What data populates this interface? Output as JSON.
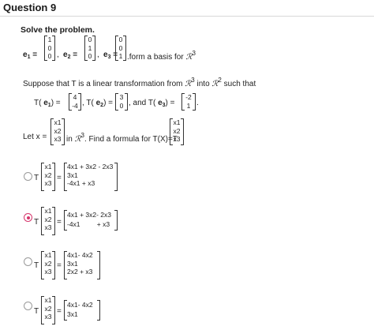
{
  "header": {
    "title": "Question 9"
  },
  "prompt": "Solve the problem.",
  "basis": {
    "e1_label": "e",
    "e1_sub": "1",
    "eq": "=",
    "e1": [
      "1",
      "0",
      "0"
    ],
    "e2_label": "e",
    "e2_sub": "2",
    "e2": [
      "0",
      "1",
      "0"
    ],
    "e3_label": "e",
    "e3_sub": "3",
    "e3": [
      "0",
      "0",
      "1"
    ],
    "sep": ",",
    "tail": ".form a basis for ",
    "R": "ℛ",
    "dim": "3"
  },
  "suppose": {
    "text1": "Suppose that T is a linear transformation from ",
    "R": "ℛ",
    "dim1": "3",
    "text2": " into ",
    "dim2": "2",
    "text3": " such that"
  },
  "images": {
    "t1_label": "T(",
    "t1_e": "e",
    "t1_sub": "1",
    "t1_close": ") =",
    "t1": [
      "4",
      "-4"
    ],
    "t2_label": ", T(",
    "t2_e": "e",
    "t2_sub": "2",
    "t2_close": ") =",
    "t2": [
      "3",
      "0"
    ],
    "t3_label": ", and T(",
    "t3_e": "e",
    "t3_sub": "3",
    "t3_close": ") =",
    "t3": [
      "-2",
      "1"
    ],
    "end": "."
  },
  "letx": {
    "text1": "Let x =",
    "x": [
      "x1",
      "x2",
      "x3"
    ],
    "text2": "in ",
    "R": "ℛ",
    "dim": "3",
    "text3": ". Find a formula for T(X)=T",
    "x2": [
      "x1",
      "x2",
      "x3"
    ]
  },
  "options": [
    {
      "T": "T",
      "eq": "=",
      "x": [
        "x1",
        "x2",
        "x3"
      ],
      "result": [
        "4x1 + 3x2 - 2x3",
        "3x1",
        "-4x1 + x3"
      ],
      "selected": false
    },
    {
      "T": "T",
      "eq": "=",
      "x": [
        "x1",
        "x2",
        "x3"
      ],
      "result": [
        "4x1 + 3x2- 2x3",
        "-4x1         + x3"
      ],
      "selected": true
    },
    {
      "T": "T",
      "eq": "=",
      "x": [
        "x1",
        "x2",
        "x3"
      ],
      "result": [
        "4x1- 4x2",
        "3x1",
        "2x2 + x3"
      ],
      "selected": false
    },
    {
      "T": "T",
      "eq": "=",
      "x": [
        "x1",
        "x2",
        "x3"
      ],
      "result": [
        "4x1- 4x2",
        "3x1"
      ],
      "selected": false
    }
  ]
}
